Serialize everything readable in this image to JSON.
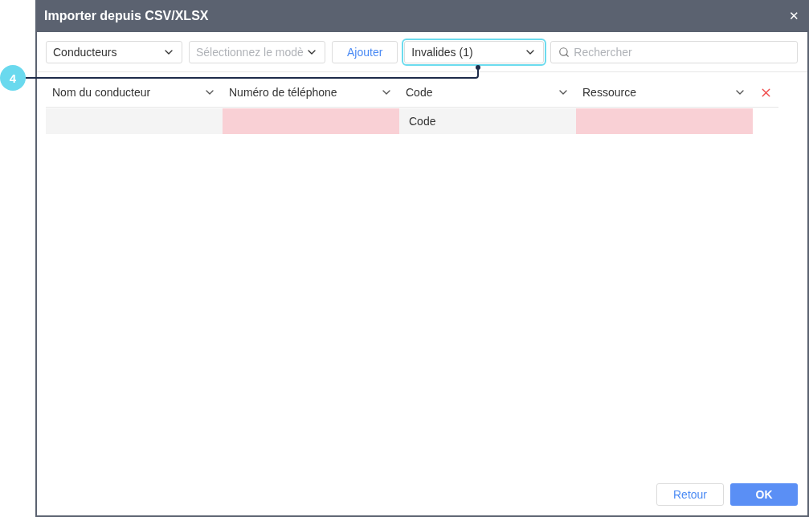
{
  "window": {
    "title": "Importer depuis CSV/XLSX",
    "close": "✕"
  },
  "toolbar": {
    "type_select": {
      "value": "Conducteurs"
    },
    "template_select": {
      "placeholder": "Sélectionnez le modè"
    },
    "add_button": "Ajouter",
    "filter_select": {
      "value": "Invalides (1)",
      "highlighted": true
    },
    "search": {
      "placeholder": "Rechercher"
    }
  },
  "callout": {
    "label": "4"
  },
  "table": {
    "columns": [
      {
        "label": "Nom du conducteur"
      },
      {
        "label": "Numéro de téléphone"
      },
      {
        "label": "Code"
      },
      {
        "label": "Ressource"
      }
    ],
    "rows": [
      {
        "cells": [
          {
            "invalid": false
          },
          {
            "invalid": true
          },
          {
            "invalid": false,
            "text": "Code"
          },
          {
            "invalid": true
          }
        ]
      }
    ]
  },
  "footer": {
    "back_button": "Retour",
    "ok_button": "OK"
  }
}
